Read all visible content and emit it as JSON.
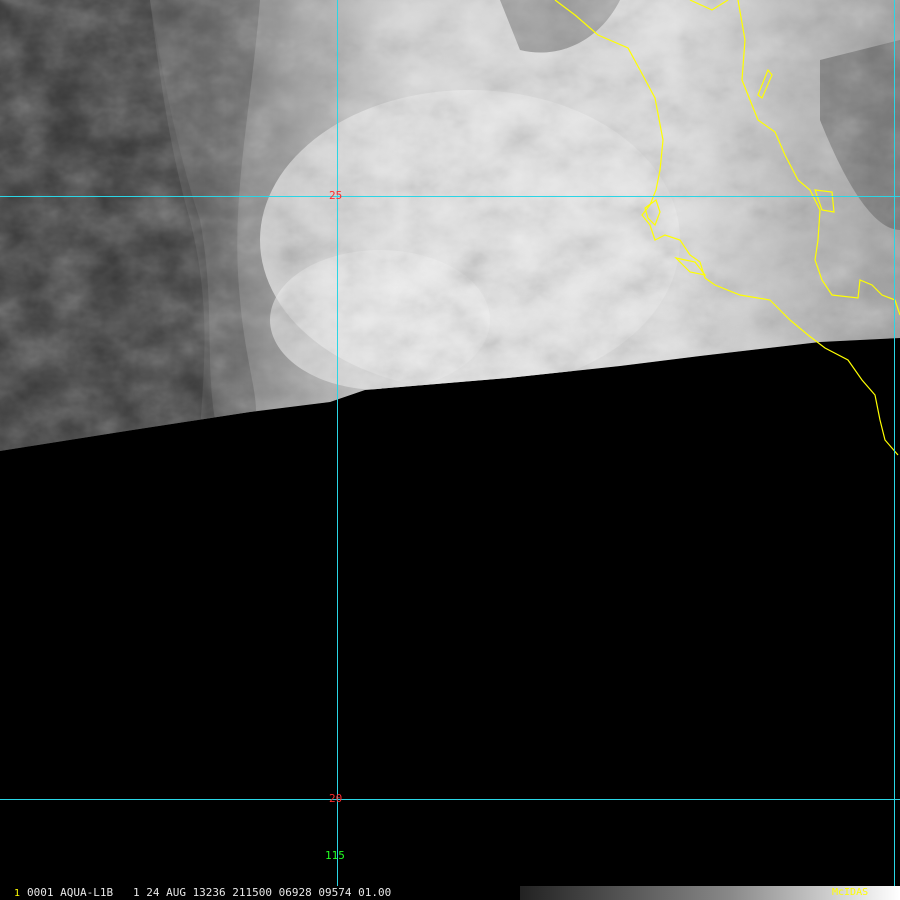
{
  "grid": {
    "lat_25": "25",
    "lat_20": "20",
    "lon_115": "115"
  },
  "colors": {
    "grid_line": "#2ad6e6",
    "coastline": "#ffff00",
    "lat_label": "#ff2a2a",
    "lon_label": "#22ff22",
    "no_data": "#000000"
  },
  "status_bar": {
    "frame_number": "1",
    "text": "0001 AQUA-L1B   1 24 AUG 13236 211500 06928 09574 01.00",
    "brand": "McIDAS"
  }
}
